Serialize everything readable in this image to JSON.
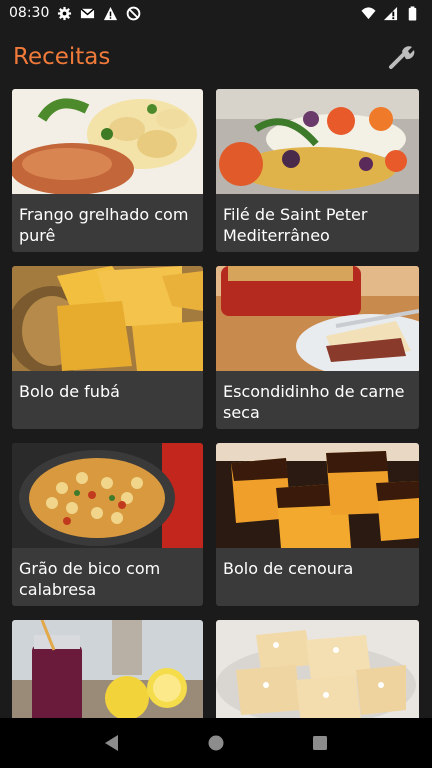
{
  "status_bar": {
    "time": "08:30",
    "icons": [
      "gear-icon",
      "gmail-icon",
      "warning-icon",
      "no-disturb-icon",
      "wifi-icon",
      "signal-icon",
      "battery-icon"
    ]
  },
  "app_bar": {
    "title": "Receitas",
    "title_color": "#f07a3a",
    "action_icon": "wrench-icon"
  },
  "recipes": [
    {
      "title": "Frango grelhado com purê",
      "image": "grilled-chicken-mashed-potato-photo"
    },
    {
      "title": "Filé de Saint Peter Mediterrâneo",
      "image": "fish-tomatoes-olives-photo"
    },
    {
      "title": "Bolo de fubá",
      "image": "cornmeal-cake-photo"
    },
    {
      "title": "Escondidinho de carne seca",
      "image": "escondidinho-dish-photo"
    },
    {
      "title": "Grão de bico com calabresa",
      "image": "chickpea-stew-photo"
    },
    {
      "title": "Bolo de cenoura",
      "image": "carrot-cake-photo"
    },
    {
      "title": "",
      "image": "berry-drink-photo"
    },
    {
      "title": "",
      "image": "coconut-cake-photo"
    }
  ],
  "nav_bar": {
    "icons": [
      "back-icon",
      "home-icon",
      "recents-icon"
    ]
  }
}
